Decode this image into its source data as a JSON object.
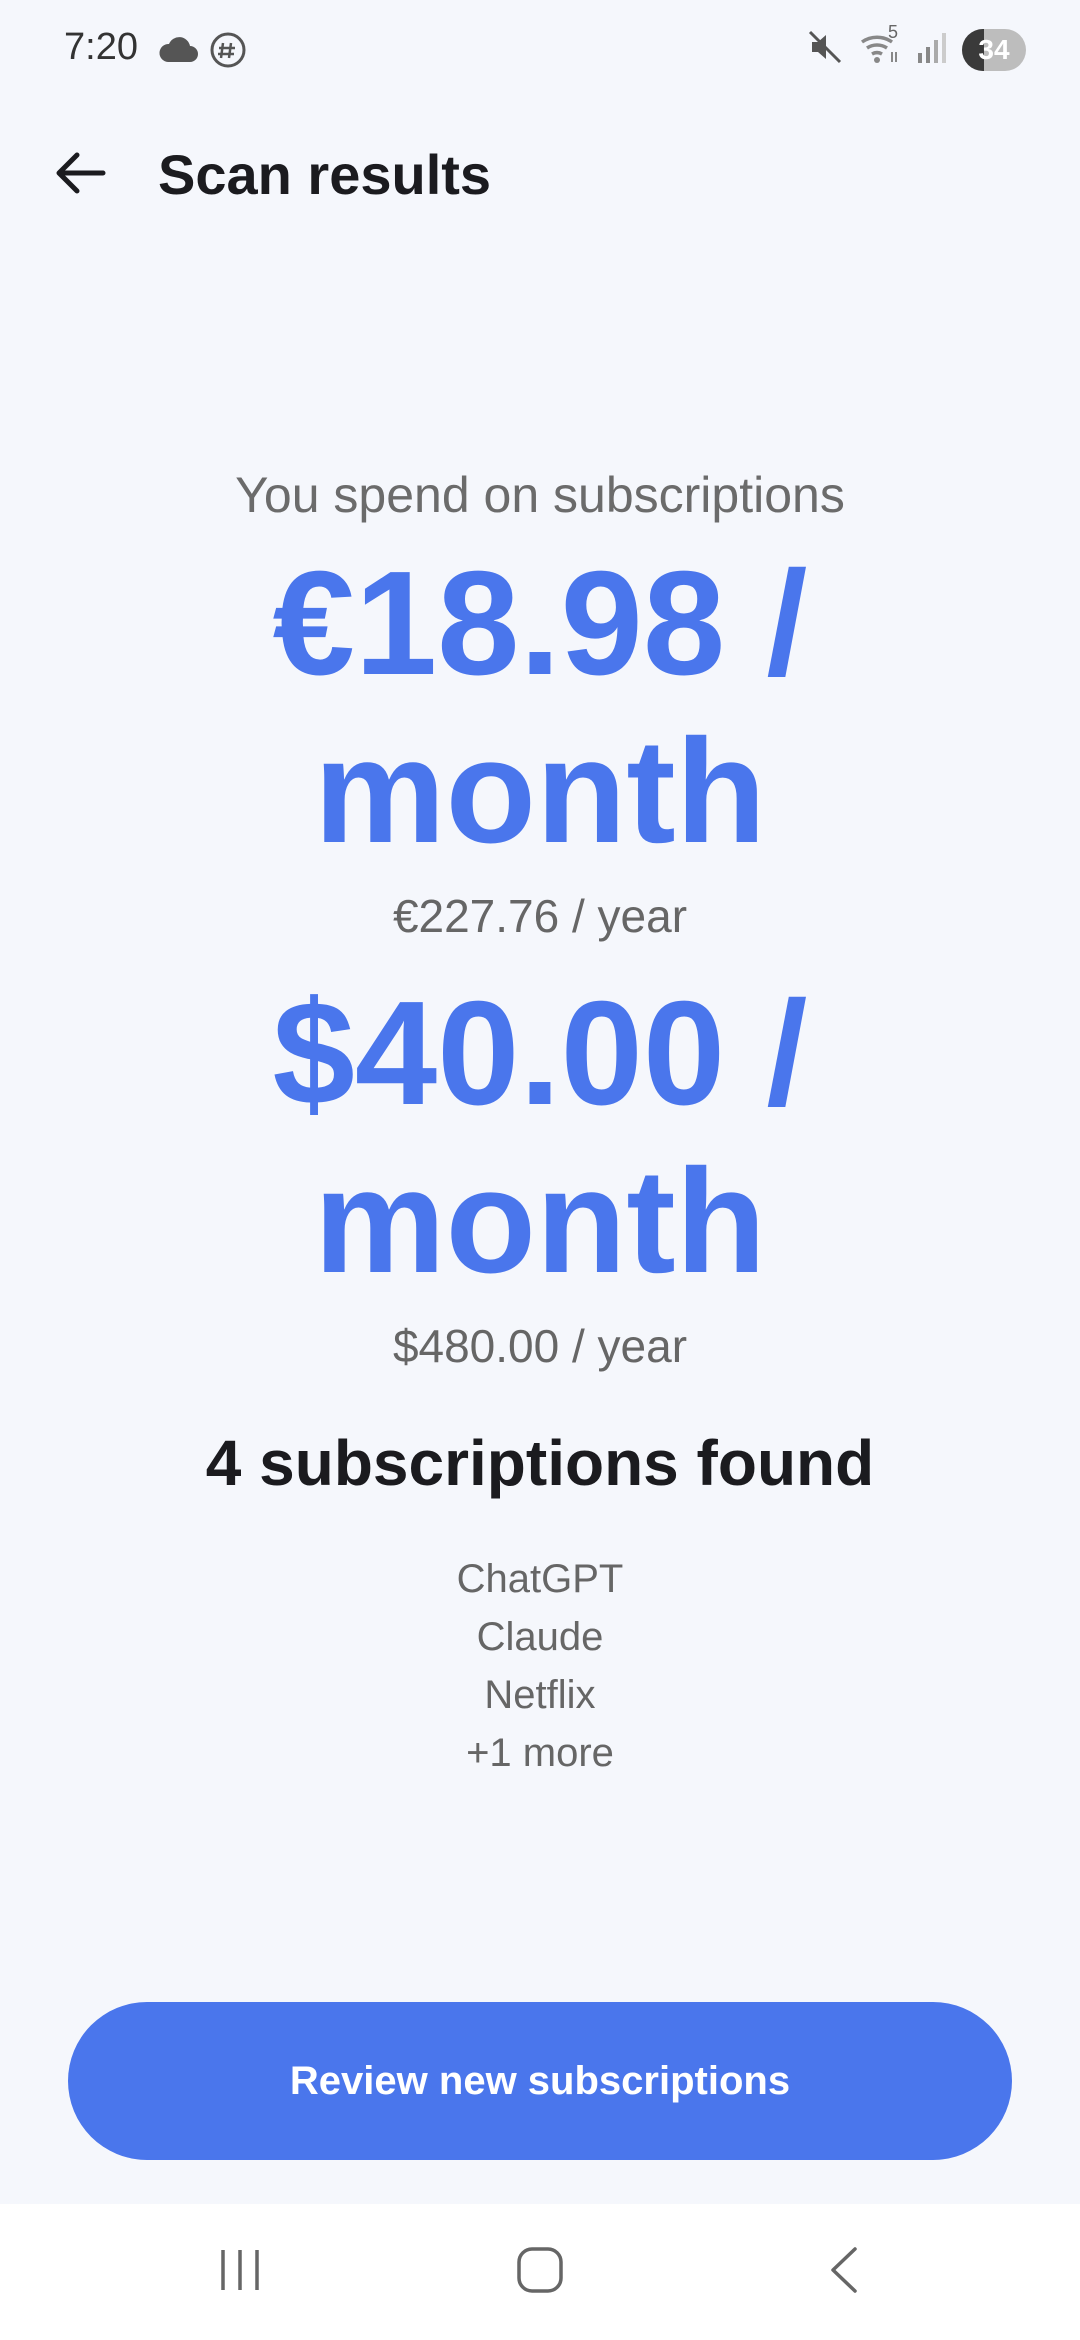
{
  "status_bar": {
    "time": "7:20",
    "battery": "34",
    "battery_level": 0.34,
    "wifi_badge": "5",
    "icons": [
      "cloud-icon",
      "vpn-icon",
      "mute-icon",
      "wifi-icon",
      "signal-icon"
    ]
  },
  "app_bar": {
    "title": "Scan results",
    "back_icon": "arrow-left-icon"
  },
  "summary": {
    "label": "You spend on subscriptions",
    "amounts": [
      {
        "monthly": "€18.98 / month",
        "yearly": "€227.76 / year"
      },
      {
        "monthly": "$40.00 / month",
        "yearly": "$480.00 / year"
      }
    ],
    "found_title": "4 subscriptions found",
    "subscriptions": [
      "ChatGPT",
      "Claude",
      "Netflix",
      "+1 more"
    ]
  },
  "cta": {
    "label": "Review new subscriptions"
  },
  "nav_bar": {
    "icons": [
      "recents-icon",
      "home-icon",
      "back-icon"
    ]
  },
  "colors": {
    "accent": "#4a76ec",
    "background": "#f5f7fc",
    "muted_text": "#666666"
  }
}
